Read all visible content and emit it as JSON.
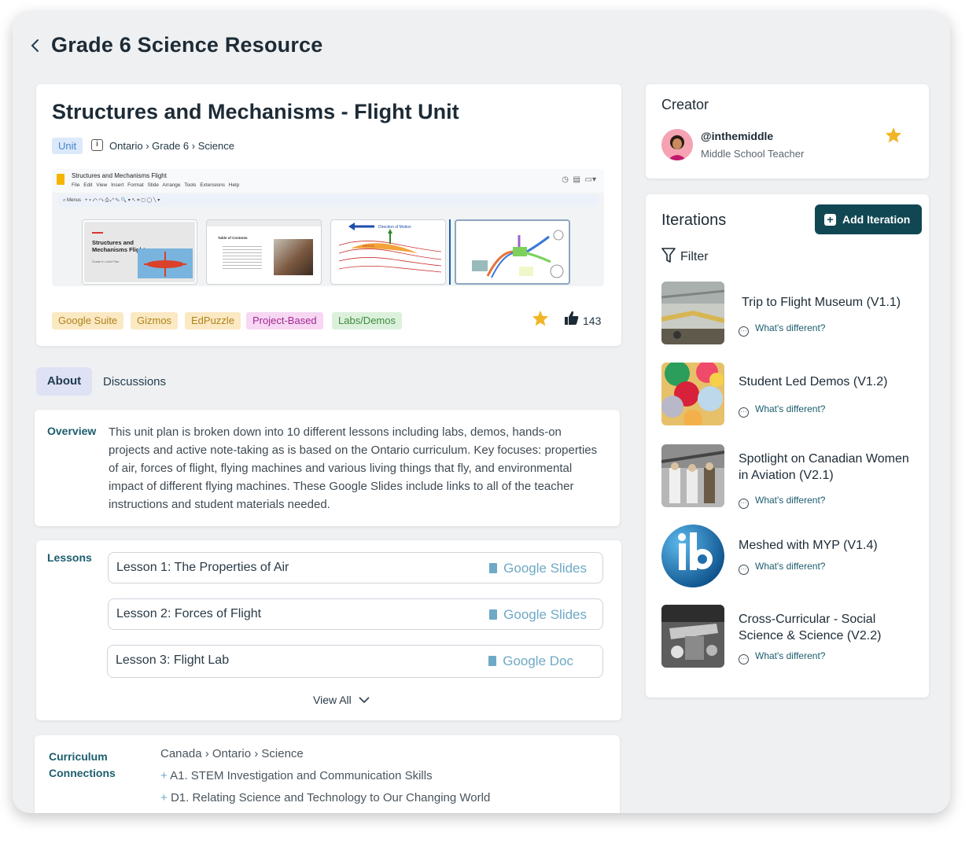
{
  "header": {
    "title": "Grade 6 Science Resource"
  },
  "unit": {
    "title": "Structures and Mechanisms - Flight Unit",
    "type_label": "Unit",
    "breadcrumb": "Ontario › Grade 6 › Science",
    "preview": {
      "doc_name": "Structures and Mechanisms Flight",
      "menu": "File Edit View Insert Format Slide Arrange Tools Extensions Help",
      "search_label": "Menus",
      "slide1_title": "Structures and Mechanisms Flight",
      "slide1_sub": "Grade 6 • Unit Plan",
      "slide2_title": "Table of Contents",
      "slide3_caption": "Direction of Motion",
      "slide3_label": "AIRFOIL"
    },
    "tags": [
      {
        "label": "Google Suite",
        "bg": "#fbe9c4",
        "color": "#b08218"
      },
      {
        "label": "Gizmos",
        "bg": "#fbe9c4",
        "color": "#b08218"
      },
      {
        "label": "EdPuzzle",
        "bg": "#fbe9c4",
        "color": "#b08218"
      },
      {
        "label": "Project-Based",
        "bg": "#f7d7f3",
        "color": "#a1288f"
      },
      {
        "label": "Labs/Demos",
        "bg": "#dcf1dc",
        "color": "#3f8a3f"
      }
    ],
    "likes": "143"
  },
  "tabs": {
    "about": "About",
    "discussions": "Discussions"
  },
  "overview": {
    "label": "Overview",
    "text": "This unit plan is broken down into 10 different lessons including labs, demos, hands-on projects and active note-taking as is based on the Ontario curriculum. Key focuses: properties of air, forces of flight, flying machines and various living things that fly, and environmental impact of different flying machines. These Google Slides include links to all of the teacher instructions and student materials needed."
  },
  "lessons": {
    "label": "Lessons",
    "items": [
      {
        "name": "Lesson 1: The Properties of Air",
        "link": "Google Slides"
      },
      {
        "name": "Lesson 2: Forces of Flight",
        "link": "Google Slides"
      },
      {
        "name": "Lesson 3: Flight Lab",
        "link": "Google Doc"
      }
    ],
    "view_all": "View All"
  },
  "curriculum": {
    "label_line1": "Curriculum",
    "label_line2": "Connections",
    "path": "Canada › Ontario › Science",
    "items": [
      "A1. STEM Investigation and Communication Skills",
      "D1. Relating Science and Technology to Our Changing World"
    ]
  },
  "creator": {
    "heading": "Creator",
    "handle": "@inthemiddle",
    "role": "Middle School Teacher"
  },
  "iterations": {
    "heading": "Iterations",
    "add_label": "Add Iteration",
    "filter_label": "Filter",
    "diff_label": "What's different?",
    "items": [
      {
        "title": "Trip to Flight Museum (V1.1)"
      },
      {
        "title": "Student Led Demos (V1.2)"
      },
      {
        "title": "Spotlight on Canadian Women in Aviation (V2.1)"
      },
      {
        "title": "Meshed with MYP (V1.4)"
      },
      {
        "title": "Cross-Curricular - Social Science & Science (V2.2)"
      }
    ]
  }
}
